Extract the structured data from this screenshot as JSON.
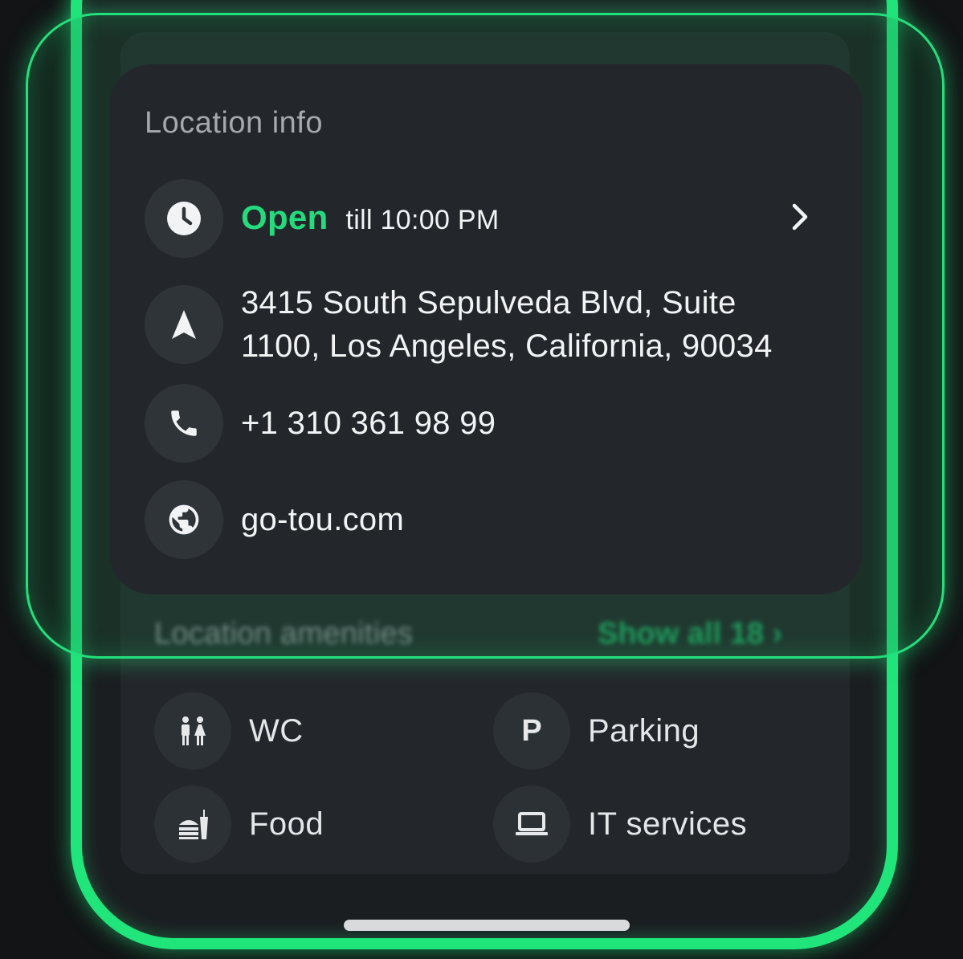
{
  "card": {
    "title": "Location info",
    "hours": {
      "status": "Open",
      "detail": "till 10:00 PM"
    },
    "address_line1": "3415 South Sepulveda Blvd, Suite",
    "address_line2": "1100, Los Angeles, California, 90034",
    "phone": "+1 310 361 98 99",
    "website": "go-tou.com"
  },
  "amenities": {
    "title": "Location amenities",
    "show_all": "Show all 18",
    "items": [
      {
        "label": "WC",
        "icon": "restroom-icon"
      },
      {
        "label": "Parking",
        "icon": "parking-icon",
        "glyph": "P"
      },
      {
        "label": "Food",
        "icon": "food-icon"
      },
      {
        "label": "IT services",
        "icon": "laptop-icon"
      }
    ]
  },
  "colors": {
    "accent": "#24dc7d",
    "frame": "#1fe57a",
    "card": "#23272b",
    "background": "#121416"
  }
}
